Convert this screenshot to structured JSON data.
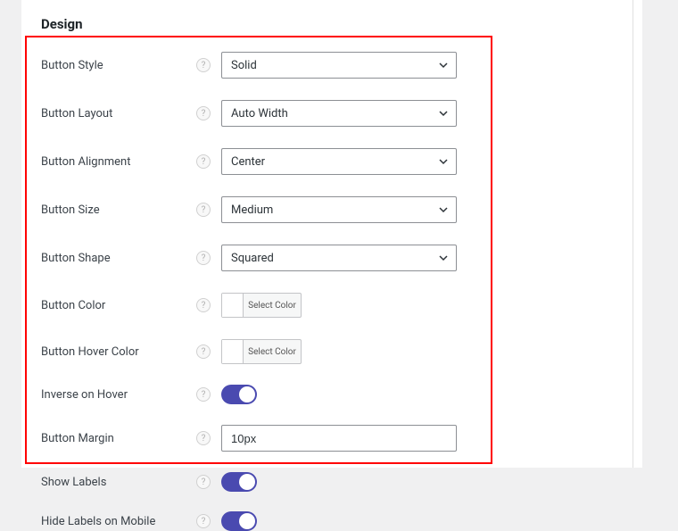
{
  "heading": "Design",
  "labels": {
    "button_style": "Button Style",
    "button_layout": "Button Layout",
    "button_alignment": "Button Alignment",
    "button_size": "Button Size",
    "button_shape": "Button Shape",
    "button_color": "Button Color",
    "button_hover_color": "Button Hover Color",
    "inverse_on_hover": "Inverse on Hover",
    "button_margin": "Button Margin",
    "show_labels": "Show Labels",
    "hide_labels_mobile": "Hide Labels on Mobile"
  },
  "values": {
    "button_style": "Solid",
    "button_layout": "Auto Width",
    "button_alignment": "Center",
    "button_size": "Medium",
    "button_shape": "Squared",
    "button_margin": "10px"
  },
  "color_picker_label": "Select Color",
  "toggles": {
    "inverse_on_hover": true,
    "show_labels": true,
    "hide_labels_mobile": true
  },
  "help_glyph": "?",
  "colors": {
    "toggle_on": "#4a4ab0"
  }
}
